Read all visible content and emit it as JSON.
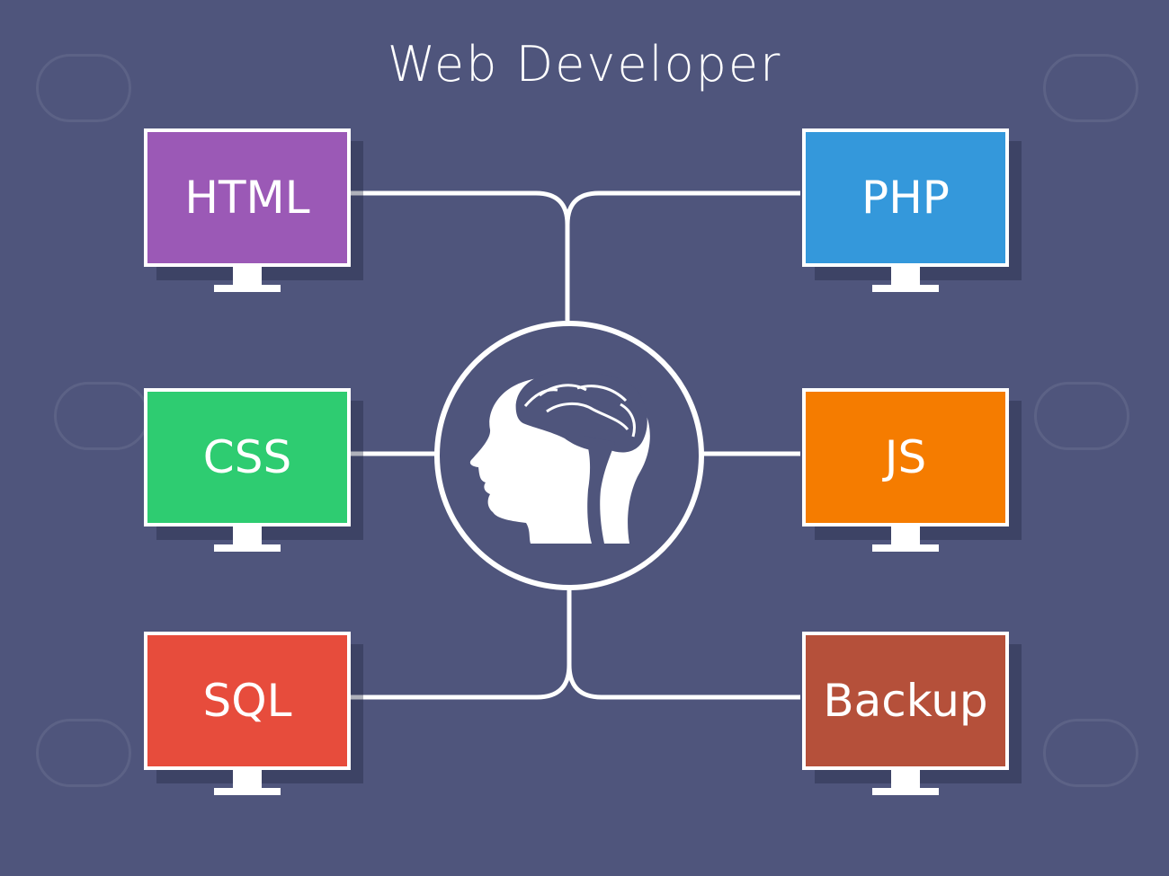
{
  "title": "Web Developer",
  "colors": {
    "background": "#4f557c",
    "lines": "#ffffff",
    "html": "#9b59b6",
    "php": "#3498db",
    "css": "#2ecc71",
    "js": "#f57c00",
    "sql": "#e74c3c",
    "backup": "#b5503a"
  },
  "center_icon": "head-brain-icon",
  "nodes": {
    "html": "HTML",
    "php": "PHP",
    "css": "CSS",
    "js": "JS",
    "sql": "SQL",
    "backup": "Backup"
  }
}
